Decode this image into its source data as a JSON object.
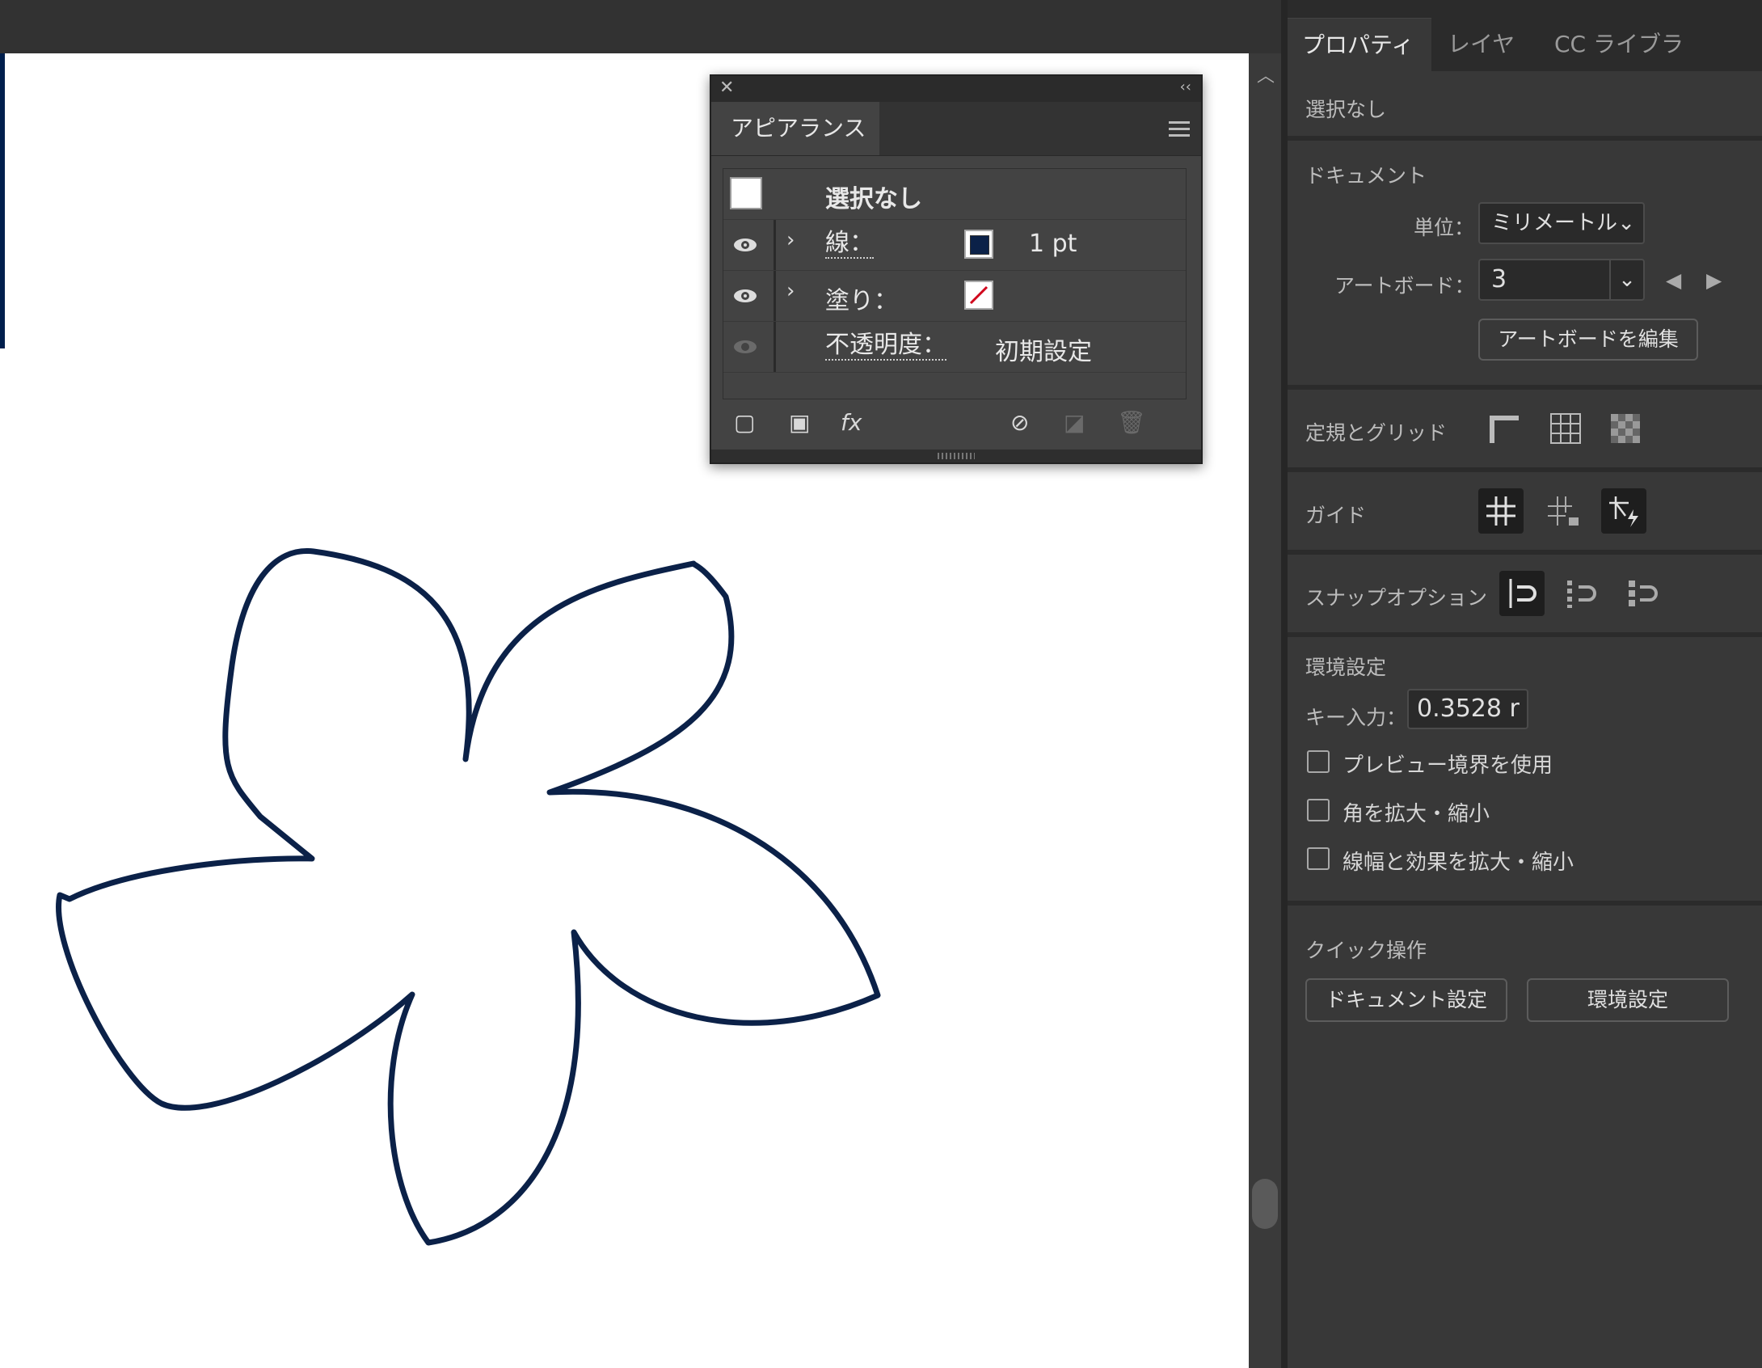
{
  "appearance_panel": {
    "tab_label": "アピアランス",
    "header_row": "選択なし",
    "rows": [
      {
        "label": "線：",
        "value": "1 pt"
      },
      {
        "label": "塗り：",
        "value": ""
      },
      {
        "label": "不透明度：",
        "value": "初期設定"
      }
    ],
    "footer_icons": [
      "new-stroke-icon",
      "new-fill-icon",
      "fx-icon",
      "clear-appearance-icon",
      "duplicate-item-icon",
      "delete-item-icon"
    ],
    "fx_label": "fx"
  },
  "properties_panel": {
    "tabs": [
      "プロパティ",
      "レイヤー",
      "CC ライブラリ"
    ],
    "selection_status": "選択なし",
    "document": {
      "title": "ドキュメント",
      "unit_label": "単位：",
      "unit_value": "ミリメートル",
      "artboard_label": "アートボード：",
      "artboard_value": "3",
      "edit_artboard_button": "アートボードを編集"
    },
    "rulers_grids": {
      "title": "定規とグリッド"
    },
    "guides": {
      "title": "ガイド"
    },
    "snap_options": {
      "title": "スナップオプション"
    },
    "preferences": {
      "title": "環境設定",
      "key_increment_label": "キー入力：",
      "key_increment_value": "0.3528 r",
      "checkboxes": [
        "プレビュー境界を使用",
        "角を拡大・縮小",
        "線幅と効果を拡大・縮小"
      ]
    },
    "quick_actions": {
      "title": "クイック操作",
      "buttons": [
        "ドキュメント設定",
        "環境設定"
      ]
    }
  },
  "colors": {
    "stroke": "#0b2148",
    "canvas": "#ffffff",
    "panel_bg": "#383838",
    "no_fill_slash": "#d0021b"
  }
}
